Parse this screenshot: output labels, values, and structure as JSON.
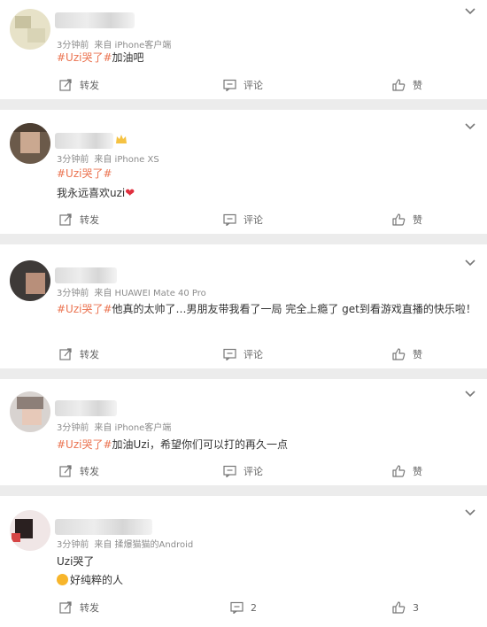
{
  "posts": [
    {
      "meta_time": "3分钟前",
      "meta_source": "来自 iPhone客户端",
      "lines": [
        {
          "tag": "#Uzi哭了#",
          "text": "加油吧"
        }
      ],
      "actions": {
        "forward": "转发",
        "comment": "评论",
        "like": "赞"
      }
    },
    {
      "meta_time": "3分钟前",
      "meta_source": "来自 iPhone XS",
      "lines": [
        {
          "tag": "#Uzi哭了#",
          "text": ""
        },
        {
          "tag": "",
          "text": "我永远喜欢uzi"
        }
      ],
      "heart": "❤",
      "actions": {
        "forward": "转发",
        "comment": "评论",
        "like": "赞"
      }
    },
    {
      "meta_time": "3分钟前",
      "meta_source": "来自 HUAWEI Mate 40 Pro",
      "lines": [
        {
          "tag": "#Uzi哭了#",
          "text": "他真的太帅了…男朋友带我看了一局 完全上瘾了 get到看游戏直播的快乐啦！"
        }
      ],
      "actions": {
        "forward": "转发",
        "comment": "评论",
        "like": "赞"
      }
    },
    {
      "meta_time": "3分钟前",
      "meta_source": "来自 iPhone客户端",
      "lines": [
        {
          "tag": "#Uzi哭了#",
          "text": "加油Uzi，希望你们可以打的再久一点"
        }
      ],
      "actions": {
        "forward": "转发",
        "comment": "评论",
        "like": "赞"
      }
    },
    {
      "meta_time": "3分钟前",
      "meta_source": "来自 揉爆猫猫的Android",
      "lines": [
        {
          "tag": "",
          "text": "Uzi哭了"
        },
        {
          "tag": "",
          "text": "好纯粹的人"
        }
      ],
      "actions": {
        "forward": "转发",
        "comment": "2",
        "like": "3"
      }
    }
  ],
  "colors": {
    "accent": "#eb7350",
    "meta": "#8c8c8c",
    "background": "#ececec"
  },
  "icons": [
    "chevron-down-icon",
    "forward-icon",
    "comment-icon",
    "like-icon",
    "heart-icon",
    "smile-icon"
  ]
}
